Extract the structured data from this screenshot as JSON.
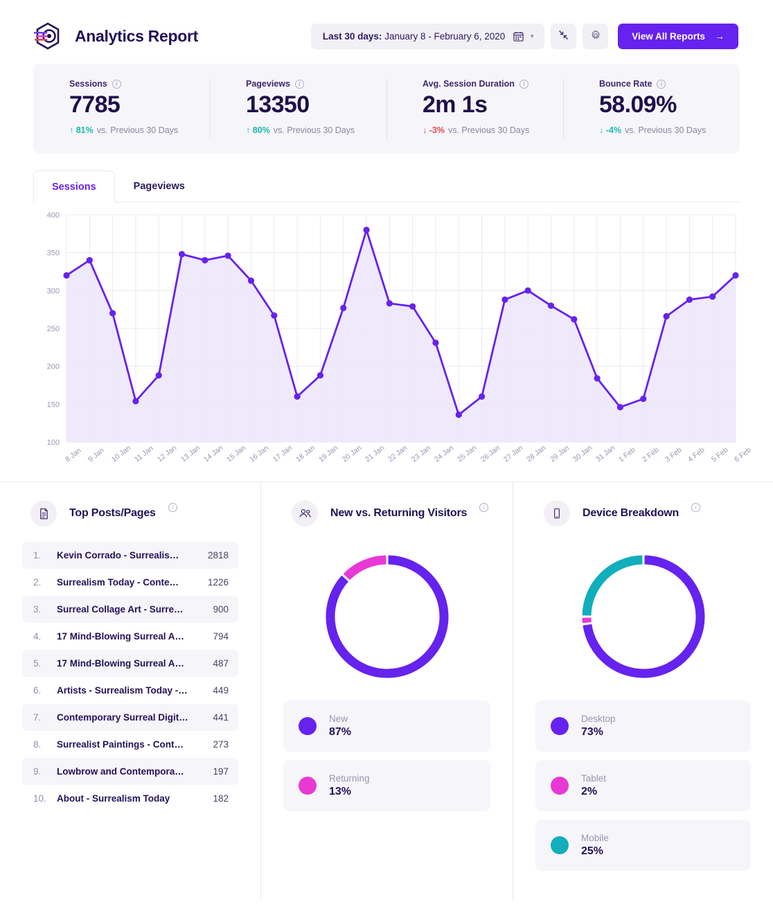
{
  "header": {
    "app_title": "Analytics Report",
    "logo_icon": "analytics-logo-icon",
    "date_range_prefix": "Last 30 days:",
    "date_range_value": " January 8 - February 6, 2020",
    "calendar_icon": "calendar-icon",
    "caret_icon": "chevron-down-icon",
    "collapse_icon": "collapse-arrows-icon",
    "settings_icon": "gear-icon",
    "view_all_label": "View All Reports",
    "view_all_arrow": "→"
  },
  "stats": [
    {
      "label": "Sessions",
      "value": "7785",
      "delta": "81%",
      "delta_dir": "up",
      "delta_tone": "good",
      "arrow": "↑",
      "compare": "vs. Previous 30 Days"
    },
    {
      "label": "Pageviews",
      "value": "13350",
      "delta": "80%",
      "delta_dir": "up",
      "delta_tone": "good",
      "arrow": "↑",
      "compare": "vs. Previous 30 Days"
    },
    {
      "label": "Avg. Session Duration",
      "value": "2m 1s",
      "delta": "-3%",
      "delta_dir": "down",
      "delta_tone": "bad",
      "arrow": "↓",
      "compare": "vs. Previous 30 Days"
    },
    {
      "label": "Bounce Rate",
      "value": "58.09%",
      "delta": "-4%",
      "delta_dir": "down",
      "delta_tone": "good",
      "arrow": "↓",
      "compare": "vs. Previous 30 Days"
    }
  ],
  "chart_tabs": [
    {
      "label": "Sessions",
      "active": true
    },
    {
      "label": "Pageviews",
      "active": false
    }
  ],
  "chart_data": {
    "type": "area",
    "title": "Sessions",
    "xlabel": "",
    "ylabel": "",
    "ylim": [
      100,
      400
    ],
    "yticks": [
      100,
      150,
      200,
      250,
      300,
      350,
      400
    ],
    "grid": true,
    "legend": "none",
    "line_color": "#6622ee",
    "fill_color": "#ece5fb",
    "categories": [
      "8 Jan",
      "9 Jan",
      "10 Jan",
      "11 Jan",
      "12 Jan",
      "13 Jan",
      "14 Jan",
      "15 Jan",
      "16 Jan",
      "17 Jan",
      "18 Jan",
      "19 Jan",
      "20 Jan",
      "21 Jan",
      "22 Jan",
      "23 Jan",
      "24 Jan",
      "25 Jan",
      "26 Jan",
      "27 Jan",
      "28 Jan",
      "29 Jan",
      "30 Jan",
      "31 Jan",
      "1 Feb",
      "2 Feb",
      "3 Feb",
      "4 Feb",
      "5 Feb",
      "6 Feb"
    ],
    "values": [
      320,
      340,
      270,
      154,
      188,
      348,
      340,
      346,
      313,
      267,
      160,
      188,
      277,
      380,
      283,
      279,
      231,
      136,
      160,
      288,
      300,
      280,
      262,
      184,
      146,
      157,
      266,
      288,
      292,
      320
    ]
  },
  "top_posts": {
    "title": "Top Posts/Pages",
    "icon": "document-icon",
    "info_icon": "info-icon",
    "rows": [
      {
        "rank": "1.",
        "title": "Kevin Corrado - Surrealis…",
        "count": "2818"
      },
      {
        "rank": "2.",
        "title": "Surrealism Today - Conte…",
        "count": "1226"
      },
      {
        "rank": "3.",
        "title": "Surreal Collage Art - Surre…",
        "count": "900"
      },
      {
        "rank": "4.",
        "title": "17 Mind-Blowing Surreal A…",
        "count": "794"
      },
      {
        "rank": "5.",
        "title": "17 Mind-Blowing Surreal A…",
        "count": "487"
      },
      {
        "rank": "6.",
        "title": "Artists - Surrealism Today -…",
        "count": "449"
      },
      {
        "rank": "7.",
        "title": "Contemporary Surreal Digit…",
        "count": "441"
      },
      {
        "rank": "8.",
        "title": "Surrealist Paintings - Cont…",
        "count": "273"
      },
      {
        "rank": "9.",
        "title": "Lowbrow and Contempora…",
        "count": "197"
      },
      {
        "rank": "10.",
        "title": "About - Surrealism Today",
        "count": "182"
      }
    ]
  },
  "visitors": {
    "title": "New vs. Returning Visitors",
    "icon": "users-icon",
    "info_icon": "info-icon",
    "chart_data": {
      "type": "pie",
      "title": "New vs. Returning Visitors",
      "labels": [
        "New",
        "Returning"
      ],
      "values": [
        87,
        13
      ],
      "colors": [
        "#6622ee",
        "#e839d4"
      ],
      "legend": "below"
    },
    "legend": [
      {
        "name": "New",
        "value": "87%",
        "color": "#6622ee"
      },
      {
        "name": "Returning",
        "value": "13%",
        "color": "#e839d4"
      }
    ]
  },
  "devices": {
    "title": "Device Breakdown",
    "icon": "mobile-icon",
    "info_icon": "info-icon",
    "chart_data": {
      "type": "pie",
      "title": "Device Breakdown",
      "labels": [
        "Desktop",
        "Tablet",
        "Mobile"
      ],
      "values": [
        73,
        2,
        25
      ],
      "colors": [
        "#6622ee",
        "#e839d4",
        "#11aebc"
      ],
      "legend": "below"
    },
    "legend": [
      {
        "name": "Desktop",
        "value": "73%",
        "color": "#6622ee"
      },
      {
        "name": "Tablet",
        "value": "2%",
        "color": "#e839d4"
      },
      {
        "name": "Mobile",
        "value": "25%",
        "color": "#11aebc"
      }
    ]
  },
  "theme": {
    "accent": "#6622ee",
    "ink": "#231158",
    "good": "#18b9ae",
    "bad": "#e8474f",
    "panel_bg": "#f6f5f9"
  }
}
